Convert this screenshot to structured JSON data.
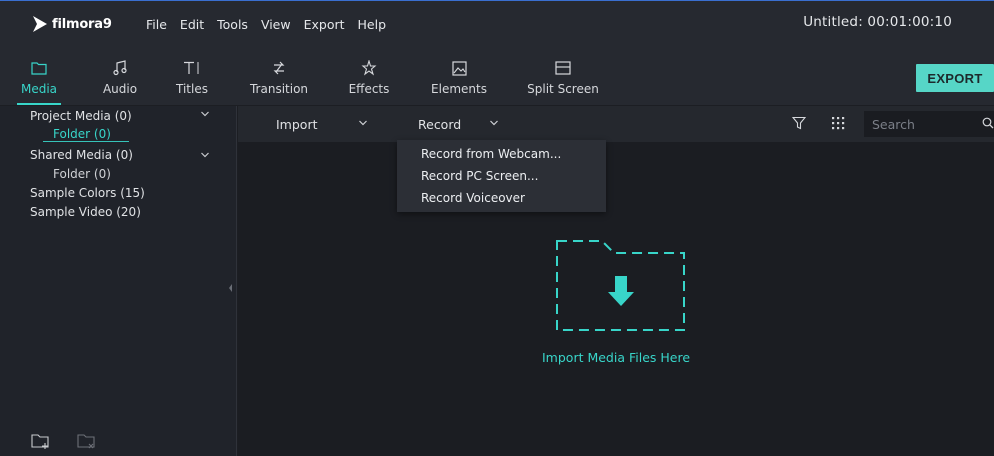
{
  "app": {
    "logo_text": "filmora9",
    "project_title": "Untitled: 00:01:00:10",
    "accent_color": "#38d5c9",
    "export_color": "#56d6c7"
  },
  "menu": {
    "items": [
      "File",
      "Edit",
      "Tools",
      "View",
      "Export",
      "Help"
    ]
  },
  "toolbar": {
    "tools": [
      {
        "label": "Media",
        "icon": "folder-icon",
        "active": true
      },
      {
        "label": "Audio",
        "icon": "music-note-icon",
        "active": false
      },
      {
        "label": "Titles",
        "icon": "text-cursor-icon",
        "active": false
      },
      {
        "label": "Transition",
        "icon": "transition-icon",
        "active": false
      },
      {
        "label": "Effects",
        "icon": "effects-sparkle-icon",
        "active": false
      },
      {
        "label": "Elements",
        "icon": "image-icon",
        "active": false
      },
      {
        "label": "Split Screen",
        "icon": "split-screen-icon",
        "active": false
      }
    ],
    "export_label": "EXPORT"
  },
  "sidebar": {
    "items": [
      {
        "label": "Project Media (0)",
        "expandable": true
      },
      {
        "label": "Folder (0)",
        "selected": true
      },
      {
        "label": "Shared Media (0)",
        "expandable": true
      },
      {
        "label": "Folder (0)"
      },
      {
        "label": "Sample Colors (15)"
      },
      {
        "label": "Sample Video (20)"
      }
    ],
    "bottom_icons": [
      "new-folder-icon",
      "delete-folder-icon"
    ]
  },
  "main": {
    "import_label": "Import",
    "record_label": "Record",
    "search_placeholder": "Search",
    "record_menu": [
      "Record from Webcam...",
      "Record PC Screen...",
      "Record Voiceover"
    ],
    "import_hint": "Import Media Files Here"
  }
}
